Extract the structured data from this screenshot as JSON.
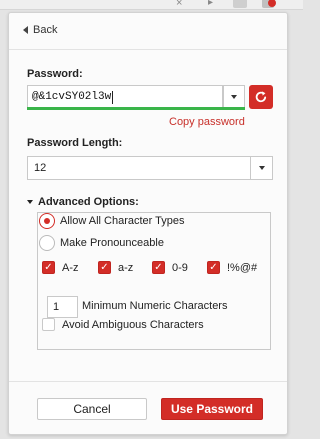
{
  "browser": {
    "close_glyph": "×",
    "arrow_glyph": "▸"
  },
  "nav": {
    "back_label": "Back"
  },
  "password": {
    "label": "Password:",
    "value": "@&1cvSY02l3w",
    "copy_link": "Copy password",
    "strength_color": "#3ab54a"
  },
  "length": {
    "label": "Password Length:",
    "value": "12"
  },
  "advanced": {
    "heading": "Advanced Options:",
    "radios": [
      {
        "label": "Allow All Character Types",
        "selected": true
      },
      {
        "label": "Make Pronounceable",
        "selected": false
      }
    ],
    "charsets": [
      {
        "label": "A-z",
        "checked": true
      },
      {
        "label": "a-z",
        "checked": true
      },
      {
        "label": "0-9",
        "checked": true
      },
      {
        "label": "!%@#",
        "checked": true
      }
    ],
    "min_numeric": {
      "value": "1",
      "label": "Minimum Numeric Characters"
    },
    "avoid_ambiguous": {
      "label": "Avoid Ambiguous Characters",
      "checked": false
    }
  },
  "footer": {
    "cancel_label": "Cancel",
    "use_label": "Use Password"
  },
  "colors": {
    "accent": "#d32d27",
    "panel_bg": "#fbfbfb",
    "page_bg": "#e4e4e4"
  }
}
